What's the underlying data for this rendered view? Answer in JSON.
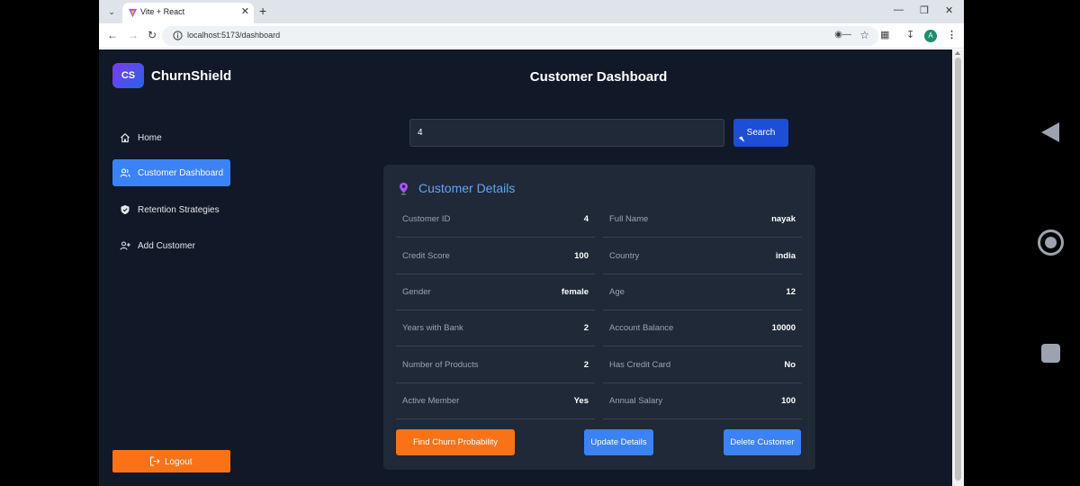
{
  "browser": {
    "tab_title": "Vite + React",
    "url": "localhost:5173/dashboard",
    "profile_initial": "A"
  },
  "app": {
    "brand_logo": "CS",
    "brand_name": "ChurnShield",
    "page_title": "Customer Dashboard"
  },
  "sidebar": {
    "items": [
      {
        "label": "Home",
        "icon": "home-icon"
      },
      {
        "label": "Customer Dashboard",
        "icon": "users-icon",
        "active": true
      },
      {
        "label": "Retention Strategies",
        "icon": "shield-icon"
      },
      {
        "label": "Add Customer",
        "icon": "user-plus-icon"
      }
    ],
    "logout_label": "Logout"
  },
  "search": {
    "value": "4",
    "button_label": "Search"
  },
  "details": {
    "title": "Customer Details",
    "fields": [
      {
        "key": "Customer ID",
        "value": "4"
      },
      {
        "key": "Full Name",
        "value": "nayak"
      },
      {
        "key": "Credit Score",
        "value": "100"
      },
      {
        "key": "Country",
        "value": "india"
      },
      {
        "key": "Gender",
        "value": "female"
      },
      {
        "key": "Age",
        "value": "12"
      },
      {
        "key": "Years with Bank",
        "value": "2"
      },
      {
        "key": "Account Balance",
        "value": "10000"
      },
      {
        "key": "Number of Products",
        "value": "2"
      },
      {
        "key": "Has Credit Card",
        "value": "No"
      },
      {
        "key": "Active Member",
        "value": "Yes"
      },
      {
        "key": "Annual Salary",
        "value": "100"
      }
    ]
  },
  "actions": {
    "churn": "Find Churn Probability",
    "update": "Update Details",
    "delete": "Delete Customer"
  },
  "colors": {
    "background": "#111827",
    "card": "#1f2937",
    "accent_blue": "#3b82f6",
    "title_blue": "#60a5fa",
    "orange": "#f97316",
    "search_blue": "#1d4ed8"
  }
}
